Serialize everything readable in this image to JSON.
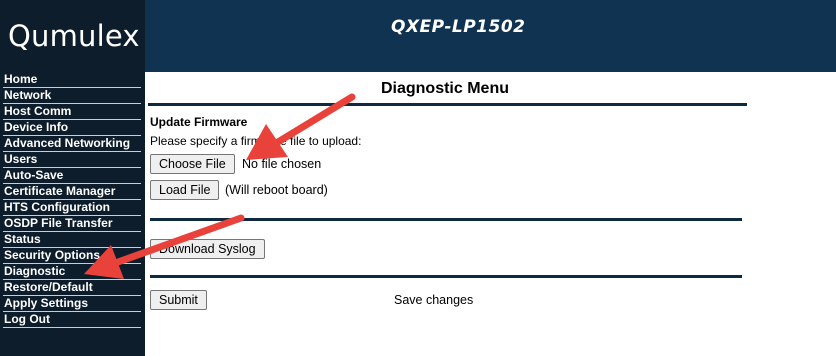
{
  "header": {
    "logo": "Qumulex",
    "device": "QXEP-LP1502"
  },
  "sidebar": {
    "items": [
      {
        "label": "Home"
      },
      {
        "label": "Network"
      },
      {
        "label": "Host Comm"
      },
      {
        "label": "Device Info"
      },
      {
        "label": "Advanced Networking"
      },
      {
        "label": "Users"
      },
      {
        "label": "Auto-Save"
      },
      {
        "label": "Certificate Manager"
      },
      {
        "label": "HTS Configuration"
      },
      {
        "label": "OSDP File Transfer"
      },
      {
        "label": "Status"
      },
      {
        "label": "Security Options"
      },
      {
        "label": "Diagnostic"
      },
      {
        "label": "Restore/Default"
      },
      {
        "label": "Apply Settings"
      },
      {
        "label": "Log Out"
      }
    ]
  },
  "main": {
    "title": "Diagnostic Menu",
    "firmware": {
      "heading": "Update Firmware",
      "instruction": "Please specify a firmware file to upload:",
      "choose_button": "Choose File",
      "file_status": "No file chosen",
      "load_button": "Load File",
      "load_note": "(Will reboot board)"
    },
    "syslog_button": "Download Syslog",
    "submit_button": "Submit",
    "save_text": "Save changes"
  },
  "annotations": {
    "arrow_color": "#e8423a"
  }
}
